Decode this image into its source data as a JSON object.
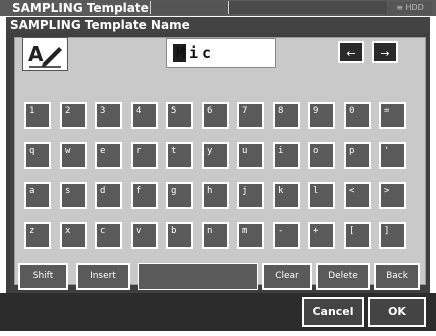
{
  "window": {
    "title": "SAMPLING Template"
  },
  "dialog": {
    "title": "SAMPLING Template Name"
  },
  "name_field": {
    "value": "Mic",
    "cursor_char": "M"
  },
  "arrows": {
    "left": "←",
    "right": "→"
  },
  "rows": [
    [
      "1",
      "2",
      "3",
      "4",
      "5",
      "6",
      "7",
      "8",
      "9",
      "0",
      "="
    ],
    [
      "q",
      "w",
      "e",
      "r",
      "t",
      "y",
      "u",
      "i",
      "o",
      "p",
      "'"
    ],
    [
      "a",
      "s",
      "d",
      "f",
      "g",
      "h",
      "j",
      "k",
      "l",
      "<",
      ">"
    ],
    [
      "z",
      "x",
      "c",
      "v",
      "b",
      "n",
      "m",
      "-",
      "+",
      "[",
      "]"
    ]
  ],
  "function_keys": {
    "shift": "Shift",
    "insert": "Insert",
    "clear": "Clear",
    "delete": "Delete",
    "back": "Back"
  },
  "buttons": {
    "cancel": "Cancel",
    "ok": "OK"
  }
}
